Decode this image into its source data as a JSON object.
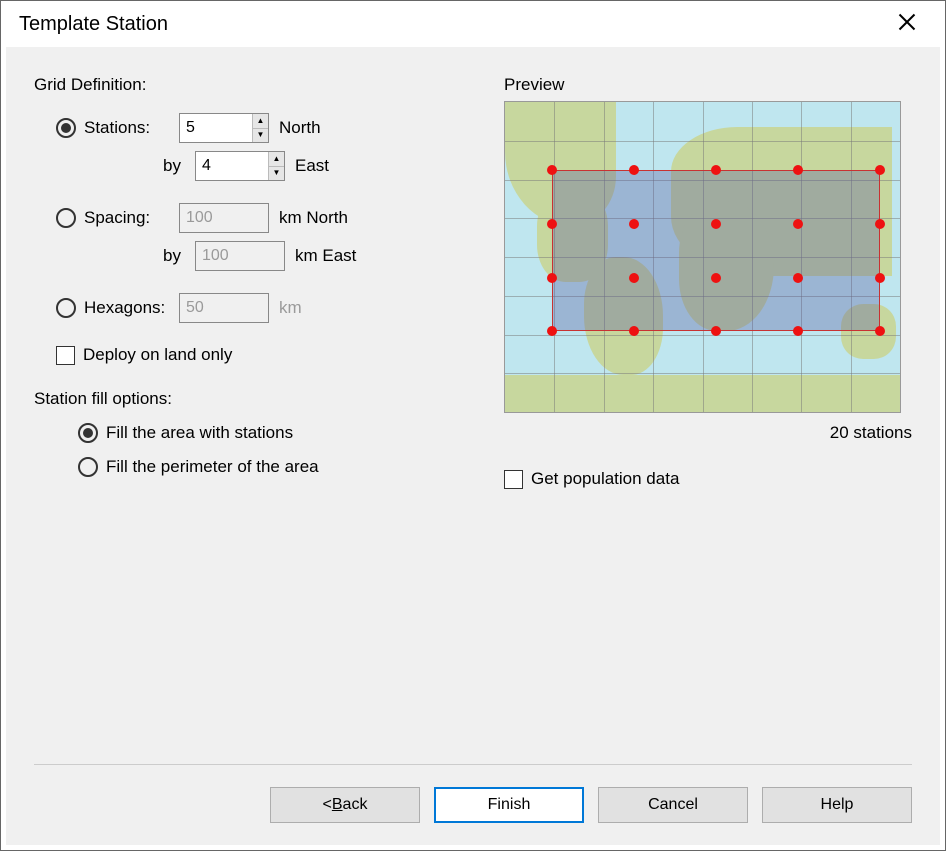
{
  "window": {
    "title": "Template Station"
  },
  "grid": {
    "heading": "Grid Definition:",
    "mode": "stations",
    "stations": {
      "label": "Stations:",
      "north": "5",
      "north_unit": "North",
      "east": "4",
      "east_unit": "East",
      "by": "by"
    },
    "spacing": {
      "label": "Spacing:",
      "north": "100",
      "north_unit": "km North",
      "east": "100",
      "east_unit": "km East",
      "by": "by"
    },
    "hexagons": {
      "label": "Hexagons:",
      "value": "50",
      "unit": "km"
    },
    "land_only": {
      "label": "Deploy on land only",
      "checked": false
    }
  },
  "fill": {
    "heading": "Station fill options:",
    "mode": "area",
    "area_label": "Fill the area with stations",
    "perimeter_label": "Fill the perimeter of the area"
  },
  "preview": {
    "heading": "Preview",
    "count_text": "20 stations",
    "aoi": {
      "left_pct": 12,
      "top_pct": 22,
      "width_pct": 83,
      "height_pct": 52
    },
    "grid_cols": 5,
    "grid_rows": 4
  },
  "population": {
    "label": "Get population data",
    "checked": false
  },
  "buttons": {
    "back_prefix": "< ",
    "back_u": "B",
    "back_rest": "ack",
    "finish": "Finish",
    "cancel": "Cancel",
    "help": "Help"
  }
}
